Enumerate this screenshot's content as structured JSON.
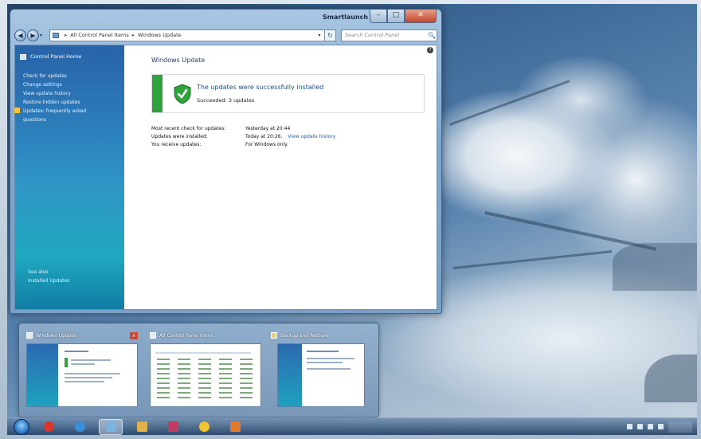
{
  "window": {
    "title": "Smartlaunch",
    "caption": {
      "minimize": "–",
      "maximize": "□",
      "close": "✕"
    },
    "nav": {
      "back": "◀",
      "forward": "▶",
      "dropdown": "▾"
    },
    "address": {
      "root_icon": "control-panel-icon",
      "crumbs": [
        "All Control Panel Items",
        "Windows Update"
      ],
      "separator": "▸",
      "arrow": "▾",
      "refresh": "↻"
    },
    "search": {
      "placeholder": "Search Control Panel",
      "icon": "🔍"
    },
    "sidebar": {
      "home": "Control Panel Home",
      "links": [
        "Check for updates",
        "Change settings",
        "View update history",
        "Restore hidden updates",
        "Updates: frequently asked",
        "questions"
      ],
      "see_also": [
        "See also",
        "Installed Updates"
      ]
    },
    "content": {
      "help": "?",
      "title": "Windows Update",
      "status_heading": "The updates were successfully installed",
      "status_sub": "Succeeded: 3 updates",
      "info": [
        {
          "key": "Most recent check for updates:",
          "value": "Yesterday at 20:44",
          "link": ""
        },
        {
          "key": "Updates were installed:",
          "value": "Today at 20:26.",
          "link": "View update history"
        },
        {
          "key": "You receive updates:",
          "value": "For Windows only.",
          "link": ""
        }
      ]
    }
  },
  "thumbnails": [
    {
      "title": "Windows Update",
      "close": "x"
    },
    {
      "title": "All Control Panel Items",
      "close": ""
    },
    {
      "title": "Backup and Restore",
      "close": ""
    }
  ],
  "taskbar": {
    "apps": [
      {
        "name": "media-player-icon",
        "color": "#d9352c"
      },
      {
        "name": "internet-explorer-icon",
        "color": "#3b8fd6"
      },
      {
        "name": "control-panel-icon",
        "color": "#7ab3e0"
      },
      {
        "name": "explorer-icon",
        "color": "#e0b04a"
      },
      {
        "name": "store-icon",
        "color": "#c23a62"
      },
      {
        "name": "chrome-icon",
        "color": "#f0c52e"
      },
      {
        "name": "paint-icon",
        "color": "#e07a2f"
      }
    ],
    "clock": ""
  },
  "colors": {
    "status_green": "#2ea33c",
    "link_blue": "#1f5fb5",
    "sidebar_top": "#2863a8"
  }
}
